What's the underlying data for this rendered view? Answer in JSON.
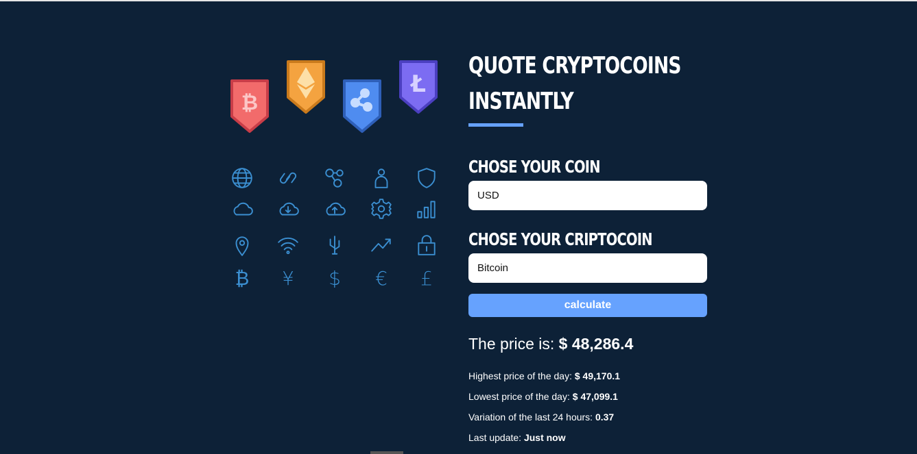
{
  "form": {
    "title_line1": "Quote Cryptocoins",
    "title_line2": "Instantly",
    "coin_label": "Chose your coin",
    "coin_value": "USD",
    "crypto_label": "Chose your criptocoin",
    "crypto_value": "Bitcoin",
    "button_label": "calculate"
  },
  "result": {
    "price_label": "The price is: ",
    "price_value": "$ 48,286.4",
    "high_label": "Highest price of the day: ",
    "high_value": "$ 49,170.1",
    "low_label": "Lowest price of the day: ",
    "low_value": "$ 47,099.1",
    "variation_label": "Variation of the last 24 hours: ",
    "variation_value": "0.37",
    "update_label": "Last update: ",
    "update_value": "Just now"
  },
  "colors": {
    "background": "#0d2137",
    "accent": "#66a2fe",
    "icon": "#3b8fd1",
    "bitcoin": "#f26b6b",
    "ethereum": "#f4a340",
    "ripple": "#4f8cf0",
    "litecoin": "#7c6cf2"
  },
  "icons": {
    "badges": [
      "bitcoin-badge-icon",
      "ethereum-badge-icon",
      "ripple-badge-icon",
      "litecoin-badge-icon"
    ],
    "grid": [
      "globe-icon",
      "link-icon",
      "nodes-icon",
      "user-icon",
      "shield-icon",
      "cloud-icon",
      "cloud-download-icon",
      "cloud-upload-icon",
      "gear-icon",
      "bar-chart-icon",
      "location-pin-icon",
      "wifi-icon",
      "usb-icon",
      "trend-up-icon",
      "lock-icon",
      "bitcoin-sign-icon",
      "yen-sign-icon",
      "dollar-sign-icon",
      "euro-sign-icon",
      "pound-sign-icon"
    ],
    "currency_glyphs": [
      "₿",
      "¥",
      "$",
      "€",
      "£"
    ]
  }
}
